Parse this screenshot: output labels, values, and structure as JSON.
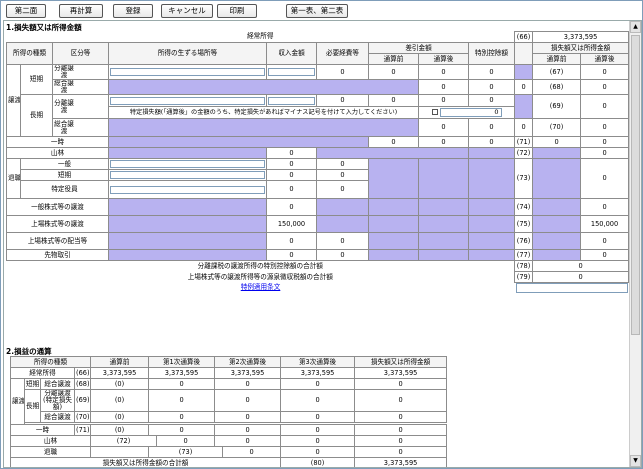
{
  "toolbar": {
    "buttons": [
      "第二面",
      "再計算",
      "登録",
      "キャンセル",
      "印刷",
      "第一表、第二表"
    ]
  },
  "sec1": {
    "title": "1.損失額又は所得金額",
    "keijo_label": "経常所得",
    "keijo_no": "(66)",
    "keijo_value": "3,373,595",
    "headers": {
      "shotoku_shurui": "所得の種類",
      "kubun": "区分等",
      "basho": "所得の生ずる場所等",
      "shunyu": "収入金額",
      "hitsuyo": "必要経費等",
      "sashihiki": "差引金額",
      "tsusanmae": "通算前",
      "tsusango": "通算後",
      "tokubetsu": "特別控除額",
      "sonshitsu": "損失額又は所得金額",
      "tsusanmae2": "通算前",
      "tsusango2": "通算後"
    },
    "joto": "譲渡",
    "tanki": "短期",
    "choki": "長期",
    "bunri": "分離譲渡",
    "sogo": "総合譲渡",
    "tokutei_note": "特定損失額(「通算後」の金額のうち、特定損失があればマイナス記号を付けて入力してください)",
    "ichiji": "一時",
    "sanrin": "山林",
    "taishoku": "退職",
    "ippan": "一般",
    "tanki2": "短期",
    "tokutei_yakuin": "特定役員",
    "ippan_kabu": "一般株式等の譲渡",
    "jojo_kabu": "上場株式等の譲渡",
    "jojo_haito": "上場株式等の配当等",
    "sakimono": "先物取引",
    "nos": [
      "(67)",
      "(68)",
      "(69)",
      "(70)",
      "(71)",
      "(72)",
      "(73)",
      "(74)",
      "(75)",
      "(76)",
      "(77)",
      "(78)",
      "(79)"
    ],
    "bunri_tokubetsu_label": "分離課税の譲渡所得の特別控除額の合計額",
    "gensen_label": "上場株式等の譲渡所得等の源泉徴収税額の合計額",
    "tokurei_link": "特例適用条文",
    "zero": "0",
    "jojo_income": "150,000",
    "jojo_result": "150,000",
    "keijo_again": "3,373,595"
  },
  "sec2": {
    "title": "2.損益の通算",
    "headers": [
      "所得の種類",
      "通算前",
      "第1次通算後",
      "第2次通算後",
      "第3次通算後",
      "損失額又は所得金額"
    ],
    "keijo": "経常所得",
    "no66": "(66)",
    "v66": "3,373,595",
    "joto": "譲渡",
    "tanki": "短期",
    "choki": "長期",
    "sogo": "総合譲渡",
    "bunri": "分離譲渡(特定損失額)",
    "no68": "(68)",
    "no69": "(69)",
    "no70": "(70)",
    "no71": "(71)",
    "no72": "(72)",
    "no73": "(73)",
    "no80": "(80)",
    "paren0": "(0)",
    "zero": "0",
    "ichiji": "一時",
    "sanrin": "山林",
    "taishoku": "退職",
    "total_label": "損失額又は所得金額の合計額",
    "total_value": "3,373,595"
  }
}
